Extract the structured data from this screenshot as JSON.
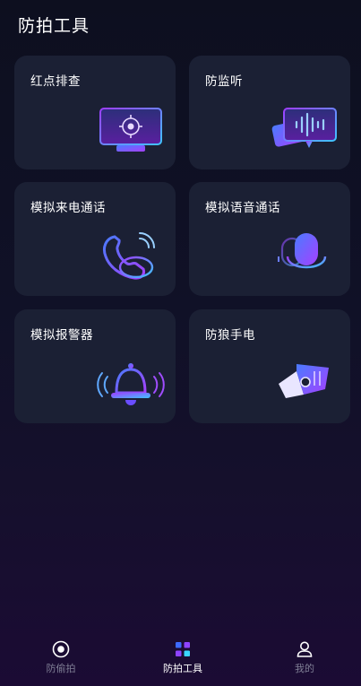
{
  "header": {
    "title": "防拍工具"
  },
  "cards": [
    {
      "label": "红点排查",
      "icon": "red-dot-scan-icon"
    },
    {
      "label": "防监听",
      "icon": "anti-eavesdrop-icon"
    },
    {
      "label": "模拟来电通话",
      "icon": "fake-call-icon"
    },
    {
      "label": "模拟语音通话",
      "icon": "fake-voice-call-icon"
    },
    {
      "label": "模拟报警器",
      "icon": "alarm-bell-icon"
    },
    {
      "label": "防狼手电",
      "icon": "flashlight-icon"
    }
  ],
  "tabbar": {
    "items": [
      {
        "label": "防偷拍",
        "icon": "camera-lens-icon",
        "active": false
      },
      {
        "label": "防拍工具",
        "icon": "tools-grid-icon",
        "active": true
      },
      {
        "label": "我的",
        "icon": "profile-icon",
        "active": false
      }
    ]
  },
  "colors": {
    "accent_blue": "#3d6bff",
    "accent_purple": "#8e43ff",
    "accent_cyan": "#3ad6ff",
    "card_bg": "#1b2034"
  }
}
